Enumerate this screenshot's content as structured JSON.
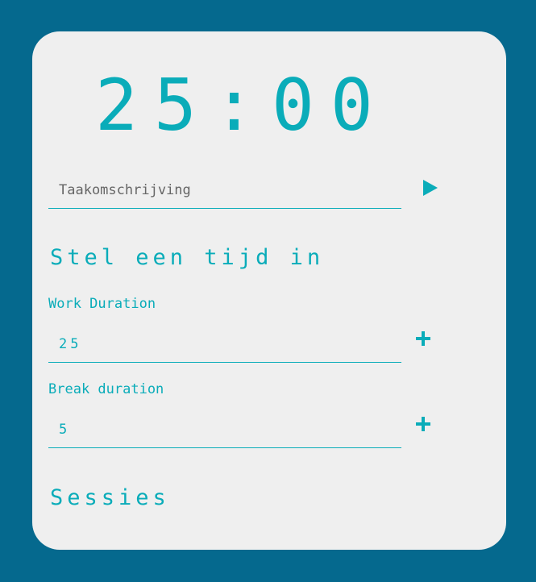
{
  "timer": {
    "display": "25:00"
  },
  "task": {
    "placeholder": "Taakomschrijving",
    "value": ""
  },
  "settings": {
    "heading": "Stel een tijd in",
    "work_label": "Work Duration",
    "work_value": "25",
    "break_label": "Break duration",
    "break_value": "5"
  },
  "sessions": {
    "heading": "Sessies"
  },
  "icons": {
    "play": "play-icon",
    "plus": "plus-icon"
  },
  "colors": {
    "background": "#05698e",
    "card": "#efefef",
    "accent": "#0aacb9"
  }
}
